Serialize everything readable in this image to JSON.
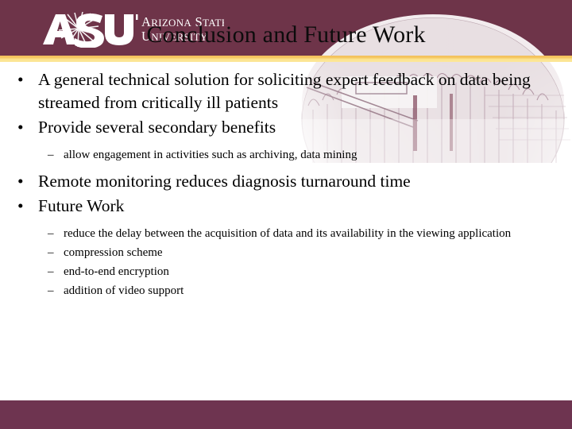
{
  "slide": {
    "title": "Conclusion and Future Work",
    "colors": {
      "header_maroon": "#6e3449",
      "footer_maroon": "#6e3450",
      "gold_rule": "#f6cc68",
      "gold_rule_light": "#fce89c",
      "body_text": "#000000",
      "title_text": "#0c0c0c",
      "logo_white": "#ffffff"
    },
    "logo": {
      "wordmark": "ASU",
      "line1": "ARIZONA STATE",
      "line2": "UNIVERSITY"
    },
    "content": [
      {
        "level": 1,
        "text": "A general technical solution for soliciting expert feedback on data being streamed from critically ill patients"
      },
      {
        "level": 1,
        "text": "Provide several secondary benefits"
      },
      {
        "level": 2,
        "text": "allow engagement in activities such as archiving, data mining"
      },
      {
        "level": 1,
        "text": "Remote monitoring reduces diagnosis turnaround time"
      },
      {
        "level": 1,
        "text": "Future Work"
      },
      {
        "level": 2,
        "text": "reduce the delay between the acquisition of data and its availability in the viewing application"
      },
      {
        "level": 2,
        "text": "compression scheme"
      },
      {
        "level": 2,
        "text": "end-to-end encryption"
      },
      {
        "level": 2,
        "text": "addition of video support"
      }
    ],
    "bullet_glyph_level1": "•",
    "bullet_glyph_level2": "–"
  }
}
